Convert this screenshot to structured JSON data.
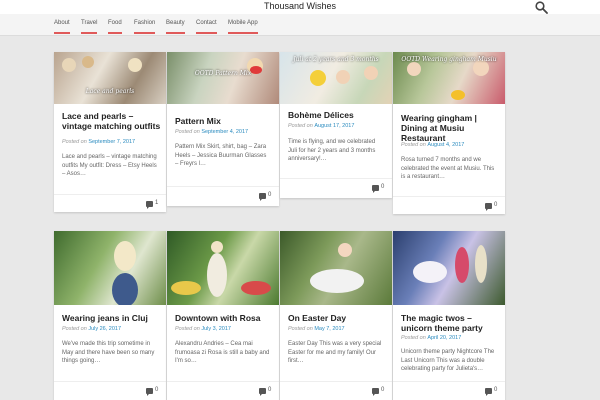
{
  "site": {
    "title": "Thousand Wishes"
  },
  "nav": [
    "About",
    "Travel",
    "Food",
    "Fashion",
    "Beauty",
    "Contact",
    "Mobile App"
  ],
  "posted_on_label": "Posted on",
  "cards": [
    {
      "title": "Lace and pearls – vintage matching outfits",
      "date": "September 7, 2017",
      "excerpt": "Lace and pearls – vintage matching outfits My outfit: Dress – Etsy Heels – Asos…",
      "comments": "1",
      "overlay": "Lace and pearls"
    },
    {
      "title": "Pattern Mix",
      "date": "September 4, 2017",
      "excerpt": "Pattern Mix Skirt, shirt, bag – Zara Heels – Jessica Buurman Glasses – Freyrs l…",
      "comments": "0",
      "overlay": "OOTD Pattern Mix"
    },
    {
      "title": "Bohème Délices",
      "date": "August 17, 2017",
      "excerpt": "Time is flying, and we celebrated Juli for her 2 years and 3 months anniversary!…",
      "comments": "0",
      "overlay": "Juli at 2 years and 3 months"
    },
    {
      "title": "Wearing gingham | Dining at Musiu Restaurant",
      "date": "August 4, 2017",
      "excerpt": "Rosa turned 7 months and we celebrated the event at Musiu. This is a restaurant…",
      "comments": "0",
      "overlay": "OOTD Wearing gingham Musiu"
    },
    {
      "title": "Wearing jeans in Cluj",
      "date": "July 26, 2017",
      "excerpt": "We've made this trip sometime in May and there have been so many things going…",
      "comments": "0",
      "overlay": ""
    },
    {
      "title": "Downtown with Rosa",
      "date": "July 3, 2017",
      "excerpt": "Alexandru Andries – Cea mai frumoasa zi Rosa is still a baby and I'm so…",
      "comments": "0",
      "overlay": ""
    },
    {
      "title": "On Easter Day",
      "date": "May 7, 2017",
      "excerpt": "Easter Day This was a very special Easter for me and my family! Our first…",
      "comments": "0",
      "overlay": ""
    },
    {
      "title": "The magic twos – unicorn theme party",
      "date": "April 20, 2017",
      "excerpt": "Unicorn theme party Nightcore The Last Unicorn This was a double celebrating party for Julieta's…",
      "comments": "0",
      "overlay": ""
    }
  ]
}
